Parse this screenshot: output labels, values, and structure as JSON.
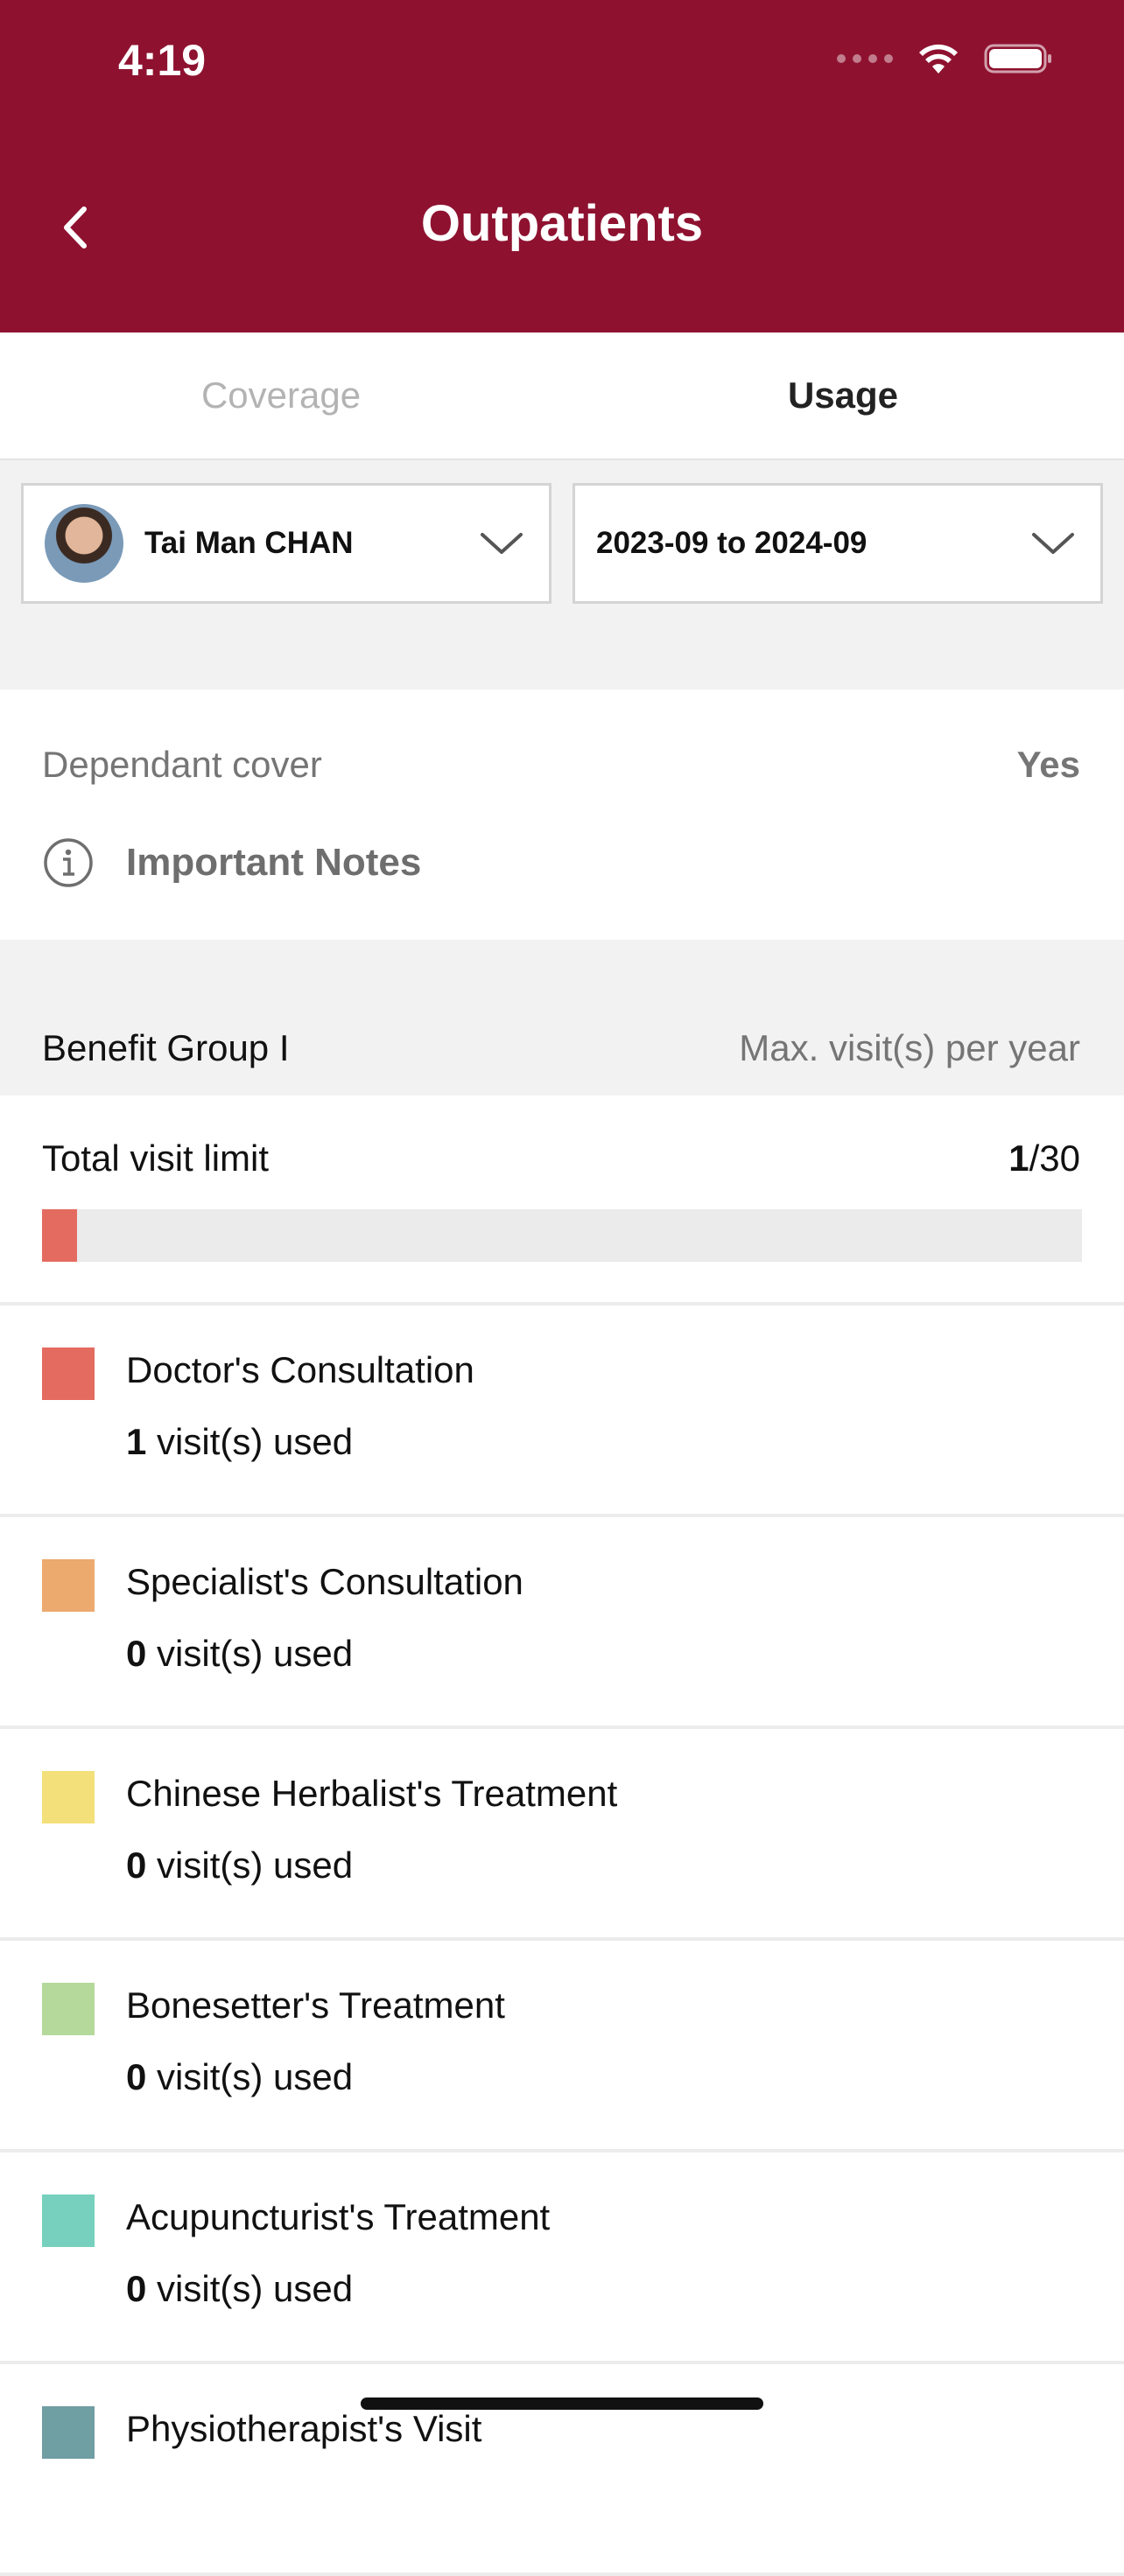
{
  "status_bar": {
    "time": "4:19"
  },
  "header": {
    "title": "Outpatients",
    "back_icon": "chevron-left-icon",
    "background": "#8e1230"
  },
  "tabs": [
    {
      "label": "Coverage",
      "active": false
    },
    {
      "label": "Usage",
      "active": true
    }
  ],
  "filters": {
    "member": {
      "name": "Tai Man CHAN"
    },
    "period": {
      "value": "2023-09 to 2024-09"
    }
  },
  "info": {
    "dependant_label": "Dependant cover",
    "dependant_value": "Yes",
    "notes_label": "Important Notes"
  },
  "benefit_group": {
    "title": "Benefit Group I",
    "subtitle": "Max. visit(s) per year",
    "total_label": "Total visit limit",
    "used": "1",
    "limit": "/30",
    "progress_fraction": 0.0333
  },
  "usage_rows": [
    {
      "title": "Doctor's Consultation",
      "count": "1",
      "suffix": " visit(s) used",
      "color": "#e46b5f"
    },
    {
      "title": "Specialist's Consultation",
      "count": "0",
      "suffix": " visit(s) used",
      "color": "#ecaa6e"
    },
    {
      "title": "Chinese Herbalist's Treatment",
      "count": "0",
      "suffix": " visit(s) used",
      "color": "#f3e07a"
    },
    {
      "title": "Bonesetter's Treatment",
      "count": "0",
      "suffix": " visit(s) used",
      "color": "#b5d99b"
    },
    {
      "title": "Acupuncturist's Treatment",
      "count": "0",
      "suffix": " visit(s) used",
      "color": "#76d0bd"
    },
    {
      "title": "Physiotherapist's Visit",
      "count": "",
      "suffix": "",
      "color": "#6f9ea3"
    }
  ]
}
